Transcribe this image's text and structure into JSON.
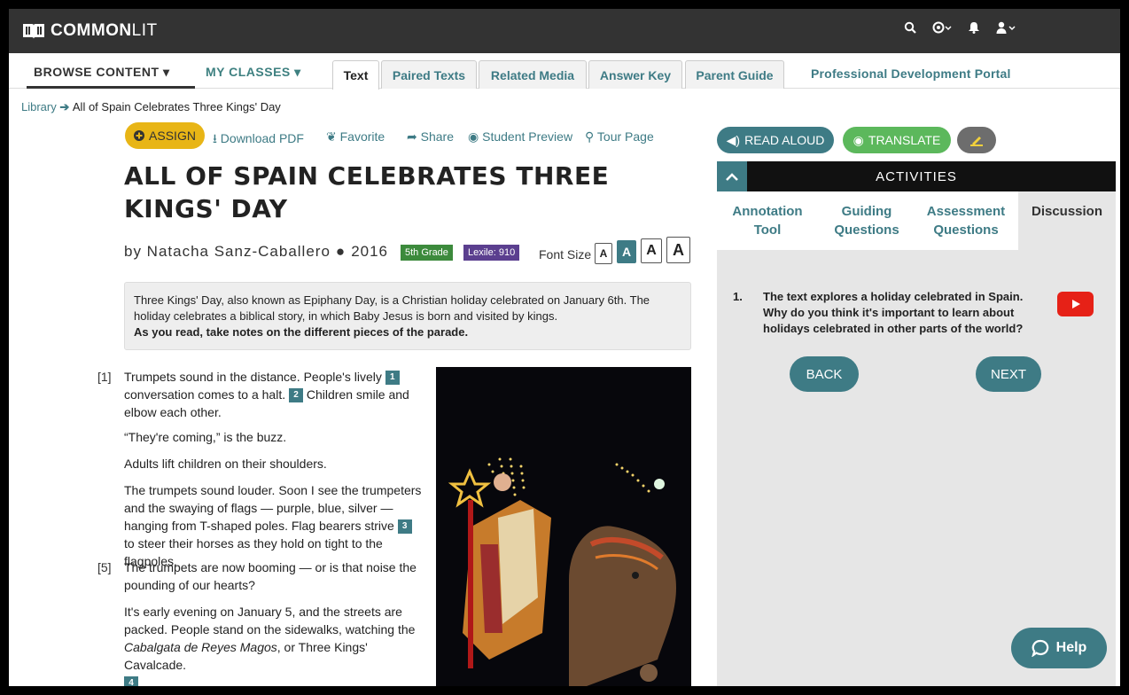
{
  "app": {
    "logo_bold": "COMMON",
    "logo_light": "LIT"
  },
  "topbar": {
    "icons": [
      "search-icon",
      "globe-icon",
      "bell-icon",
      "user-icon"
    ]
  },
  "nav": {
    "browse": "BROWSE CONTENT",
    "classes": "MY CLASSES",
    "tabs": [
      "Text",
      "Paired Texts",
      "Related Media",
      "Answer Key",
      "Parent Guide"
    ],
    "active_tab": "Text",
    "pdp": "Professional Development Portal"
  },
  "breadcrumb": {
    "root": "Library",
    "current": "All of Spain Celebrates Three Kings' Day"
  },
  "actions": {
    "assign": "ASSIGN",
    "download": "Download PDF",
    "favorite": "Favorite",
    "share": "Share",
    "preview": "Student Preview",
    "tour": "Tour Page"
  },
  "text": {
    "title_line1": "ALL OF SPAIN CELEBRATES THREE",
    "title_line2": "KINGS' DAY",
    "author": "by Natacha Sanz-Caballero",
    "year": "2016",
    "grade": "5th Grade",
    "lexile": "Lexile: 910",
    "font_size_label": "Font Size",
    "font_sizes": [
      "A",
      "A",
      "A",
      "A"
    ],
    "intro": "Three Kings' Day, also known as Epiphany Day, is a Christian holiday celebrated on January 6th. The holiday celebrates a biblical story, in which Baby Jesus is born and visited by kings.",
    "intro_bold": "As you read, take notes on the different pieces of the parade.",
    "p1_num": "[1]",
    "p1_a": "Trumpets sound in the distance. People's lively",
    "p1_b": "conversation comes to a halt.",
    "p1_c": "Children smile and elbow each other.",
    "p2": "“They're coming,” is the buzz.",
    "p3": "Adults lift children on their shoulders.",
    "p4_a": "The trumpets sound louder. Soon I see the trumpeters and the swaying of flags — purple, blue, silver — hanging from T-shaped poles. Flag bearers strive",
    "p4_b": "to steer their horses as they hold on tight to the flagpoles.",
    "p5_num": "[5]",
    "p5": "The trumpets are now booming — or is that noise the pounding of our hearts?",
    "p6_a": "It's early evening on January 5, and the streets are packed. People stand on the sidewalks, watching the",
    "p6_em": "Cabalgata de Reyes Magos",
    "p6_b": ", or Three Kings' Cavalcade.",
    "refs": [
      "1",
      "2",
      "3",
      "4"
    ]
  },
  "right": {
    "read_aloud": "READ ALOUD",
    "translate": "TRANSLATE",
    "activities": "ACTIVITIES",
    "tabs": {
      "annotation_1": "Annotation",
      "annotation_2": "Tool",
      "guiding_1": "Guiding",
      "guiding_2": "Questions",
      "assessment_1": "Assessment",
      "assessment_2": "Questions",
      "discussion": "Discussion"
    },
    "question_num": "1.",
    "question": "The text explores a holiday celebrated in Spain. Why do you think it's important to learn about holidays celebrated in other parts of the world?",
    "back": "BACK",
    "next": "NEXT"
  },
  "help": "Help",
  "colors": {
    "teal": "#3e7b85",
    "gold": "#e8b516",
    "green": "#5cb85c",
    "purple": "#5b3f8f",
    "grade_green": "#3c8a3c",
    "dark": "#333333"
  }
}
